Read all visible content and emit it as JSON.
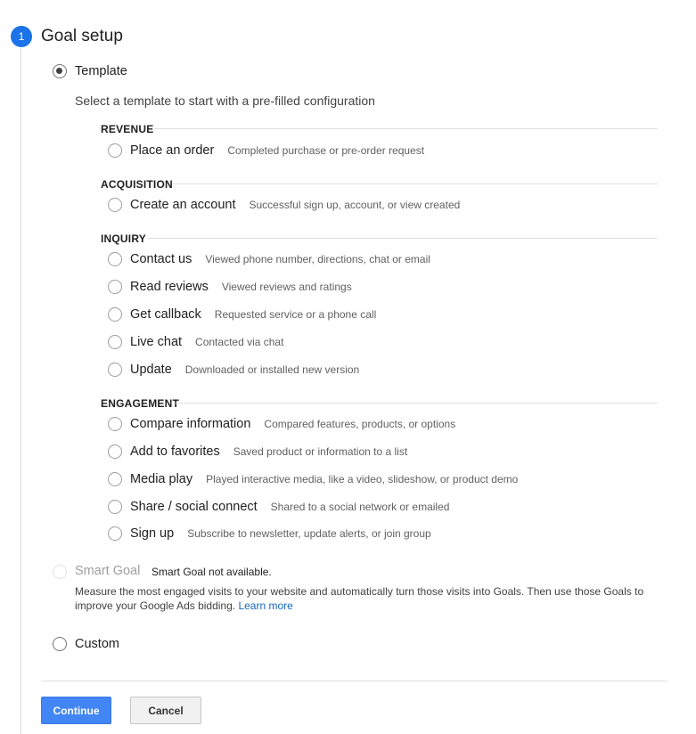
{
  "step": {
    "number": "1",
    "title": "Goal setup"
  },
  "template_option": {
    "label": "Template",
    "selected": true
  },
  "intro_text": "Select a template to start with a pre-filled configuration",
  "sections": {
    "revenue": {
      "label": "REVENUE",
      "items": [
        {
          "name": "Place an order",
          "desc": "Completed purchase or pre-order request"
        }
      ]
    },
    "acquisition": {
      "label": "ACQUISITION",
      "items": [
        {
          "name": "Create an account",
          "desc": "Successful sign up, account, or view created"
        }
      ]
    },
    "inquiry": {
      "label": "INQUIRY",
      "items": [
        {
          "name": "Contact us",
          "desc": "Viewed phone number, directions, chat or email"
        },
        {
          "name": "Read reviews",
          "desc": "Viewed reviews and ratings"
        },
        {
          "name": "Get callback",
          "desc": "Requested service or a phone call"
        },
        {
          "name": "Live chat",
          "desc": "Contacted via chat"
        },
        {
          "name": "Update",
          "desc": "Downloaded or installed new version"
        }
      ]
    },
    "engagement": {
      "label": "ENGAGEMENT",
      "items": [
        {
          "name": "Compare information",
          "desc": "Compared features, products, or options"
        },
        {
          "name": "Add to favorites",
          "desc": "Saved product or information to a list"
        },
        {
          "name": "Media play",
          "desc": "Played interactive media, like a video, slideshow, or product demo"
        },
        {
          "name": "Share / social connect",
          "desc": "Shared to a social network or emailed"
        },
        {
          "name": "Sign up",
          "desc": "Subscribe to newsletter, update alerts, or join group"
        }
      ]
    }
  },
  "smart_goal": {
    "label": "Smart Goal",
    "note": "Smart Goal not available.",
    "description": "Measure the most engaged visits to your website and automatically turn those visits into Goals. Then use those Goals to improve your Google Ads bidding.",
    "learn_more": "Learn more",
    "disabled": true
  },
  "custom_option": {
    "label": "Custom"
  },
  "buttons": {
    "continue": "Continue",
    "cancel": "Cancel"
  },
  "colors": {
    "accent": "#1a73e8",
    "primary_button": "#4285f4",
    "link": "#1565c0"
  }
}
